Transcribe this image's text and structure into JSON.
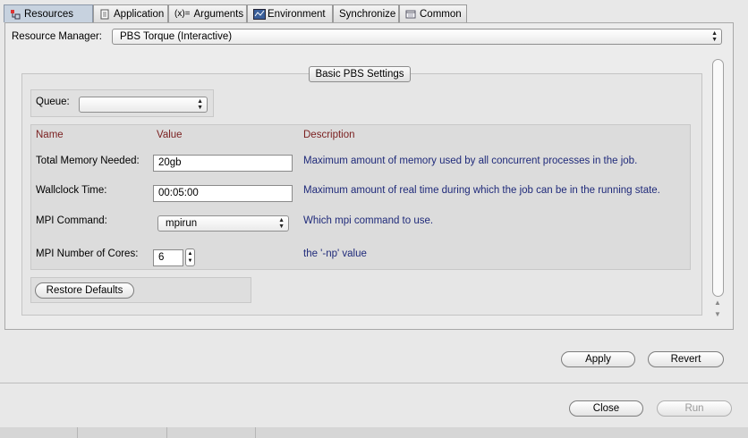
{
  "tabs": [
    {
      "label": "Resources",
      "icon": "resources-icon",
      "active": true
    },
    {
      "label": "Application",
      "icon": "document-icon",
      "active": false
    },
    {
      "label": "Arguments",
      "icon": "arguments-icon",
      "active": false
    },
    {
      "label": "Environment",
      "icon": "environment-icon",
      "active": false
    },
    {
      "label": "Synchronize",
      "icon": "",
      "active": false
    },
    {
      "label": "Common",
      "icon": "common-icon",
      "active": false
    }
  ],
  "resource_manager": {
    "label": "Resource Manager:",
    "value": "PBS Torque (Interactive)"
  },
  "group": {
    "title": "Basic PBS Settings"
  },
  "queue": {
    "label": "Queue:",
    "value": ""
  },
  "table": {
    "headers": {
      "name": "Name",
      "value": "Value",
      "description": "Description"
    },
    "rows": {
      "memory": {
        "name": "Total Memory Needed:",
        "value": "20gb",
        "description": "Maximum amount of memory used by all concurrent processes in the job."
      },
      "wallclock": {
        "name": "Wallclock Time:",
        "value": "00:05:00",
        "description": "Maximum amount of real time during which the job can be in the running state."
      },
      "mpi_command": {
        "name": "MPI Command:",
        "value": "mpirun",
        "description": "Which mpi command to use."
      },
      "mpi_cores": {
        "name": "MPI Number of Cores:",
        "value": "6",
        "description": "the '-np' value"
      }
    }
  },
  "buttons": {
    "restore_defaults": "Restore Defaults",
    "apply": "Apply",
    "revert": "Revert",
    "close": "Close",
    "run": "Run"
  },
  "colors": {
    "header_text": "#7a1f1f",
    "description_text": "#1f2a7a",
    "active_tab": "#c7d2df"
  }
}
